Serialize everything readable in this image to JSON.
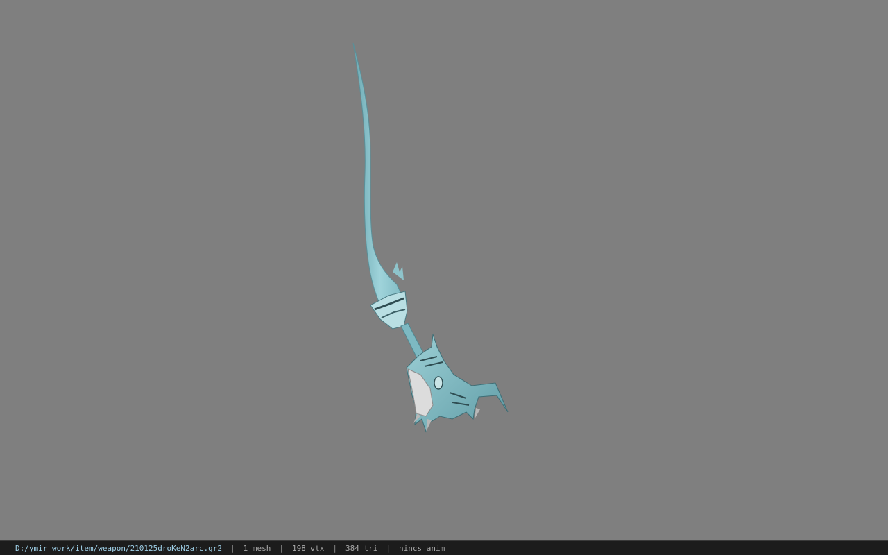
{
  "viewer": {
    "background_color": "#7f7f7f",
    "model_color": "#8fc7cf",
    "model_icon": "curved-blade-weapon"
  },
  "status_bar": {
    "file_path": "D:/ymir work/item/weapon/210125droKeN2arc.gr2",
    "mesh_count": "1 mesh",
    "vertex_count": "198 vtx",
    "triangle_count": "384 tri",
    "animation": "nincs anim",
    "separator": "|"
  }
}
